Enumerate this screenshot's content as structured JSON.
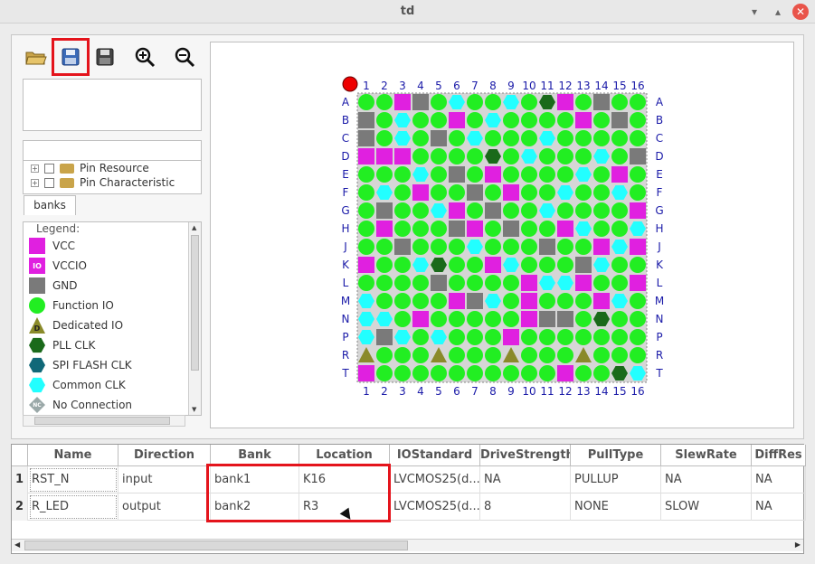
{
  "window": {
    "title": "td"
  },
  "toolbar": {
    "buttons": [
      {
        "name": "open-folder-icon",
        "glyph": "📂"
      },
      {
        "name": "save-blue-icon",
        "glyph": "💾",
        "highlighted": true
      },
      {
        "name": "save-icon",
        "glyph": "🖫"
      },
      {
        "name": "zoom-in-icon",
        "glyph": "🔍"
      },
      {
        "name": "zoom-out-icon",
        "glyph": "🔎"
      }
    ]
  },
  "tree": {
    "items": [
      {
        "label": "Pin Resource"
      },
      {
        "label": "Pin Characteristic"
      }
    ],
    "tab": "banks"
  },
  "legend": {
    "title": "Legend:",
    "items": [
      {
        "label": "VCC",
        "icon": "vcc-square",
        "color": "#e020e0"
      },
      {
        "label": "VCCIO",
        "icon": "vccio-square",
        "color": "#e020e0",
        "badge": "IO"
      },
      {
        "label": "GND",
        "icon": "gnd-square",
        "color": "#7a7a7a"
      },
      {
        "label": "Function IO",
        "icon": "function-io-circle",
        "color": "#22ee22"
      },
      {
        "label": "Dedicated IO",
        "icon": "dedicated-io-triangle",
        "color": "#8a8a2a",
        "badge": "D"
      },
      {
        "label": "PLL CLK",
        "icon": "pll-clk-hexagon",
        "color": "#1a6a1a"
      },
      {
        "label": "SPI FLASH CLK",
        "icon": "spi-flash-clk-hexagon",
        "color": "#106878"
      },
      {
        "label": "Common CLK",
        "icon": "common-clk-hexagon",
        "color": "#22ffff"
      },
      {
        "label": "No Connection",
        "icon": "no-connection-diamond",
        "color": "#9aa8a8",
        "badge": "NC"
      }
    ]
  },
  "pin_grid": {
    "columns": [
      "1",
      "2",
      "3",
      "4",
      "5",
      "6",
      "7",
      "8",
      "9",
      "10",
      "11",
      "12",
      "13",
      "14",
      "15",
      "16"
    ],
    "rows": [
      "A",
      "B",
      "C",
      "D",
      "E",
      "F",
      "G",
      "H",
      "J",
      "K",
      "L",
      "M",
      "N",
      "P",
      "R",
      "T"
    ]
  },
  "table": {
    "columns": [
      "Name",
      "Direction",
      "Bank",
      "Location",
      "IOStandard",
      "DriveStrength",
      "PullType",
      "SlewRate",
      "DiffRes"
    ],
    "rows": [
      {
        "index": "1",
        "cells": [
          "RST_N",
          "input",
          "bank1",
          "K16",
          "LVCMOS25(d...",
          "NA",
          "PULLUP",
          "NA",
          "NA"
        ]
      },
      {
        "index": "2",
        "cells": [
          "R_LED",
          "output",
          "bank2",
          "R3",
          "LVCMOS25(d...",
          "8",
          "NONE",
          "SLOW",
          "NA"
        ]
      }
    ]
  }
}
